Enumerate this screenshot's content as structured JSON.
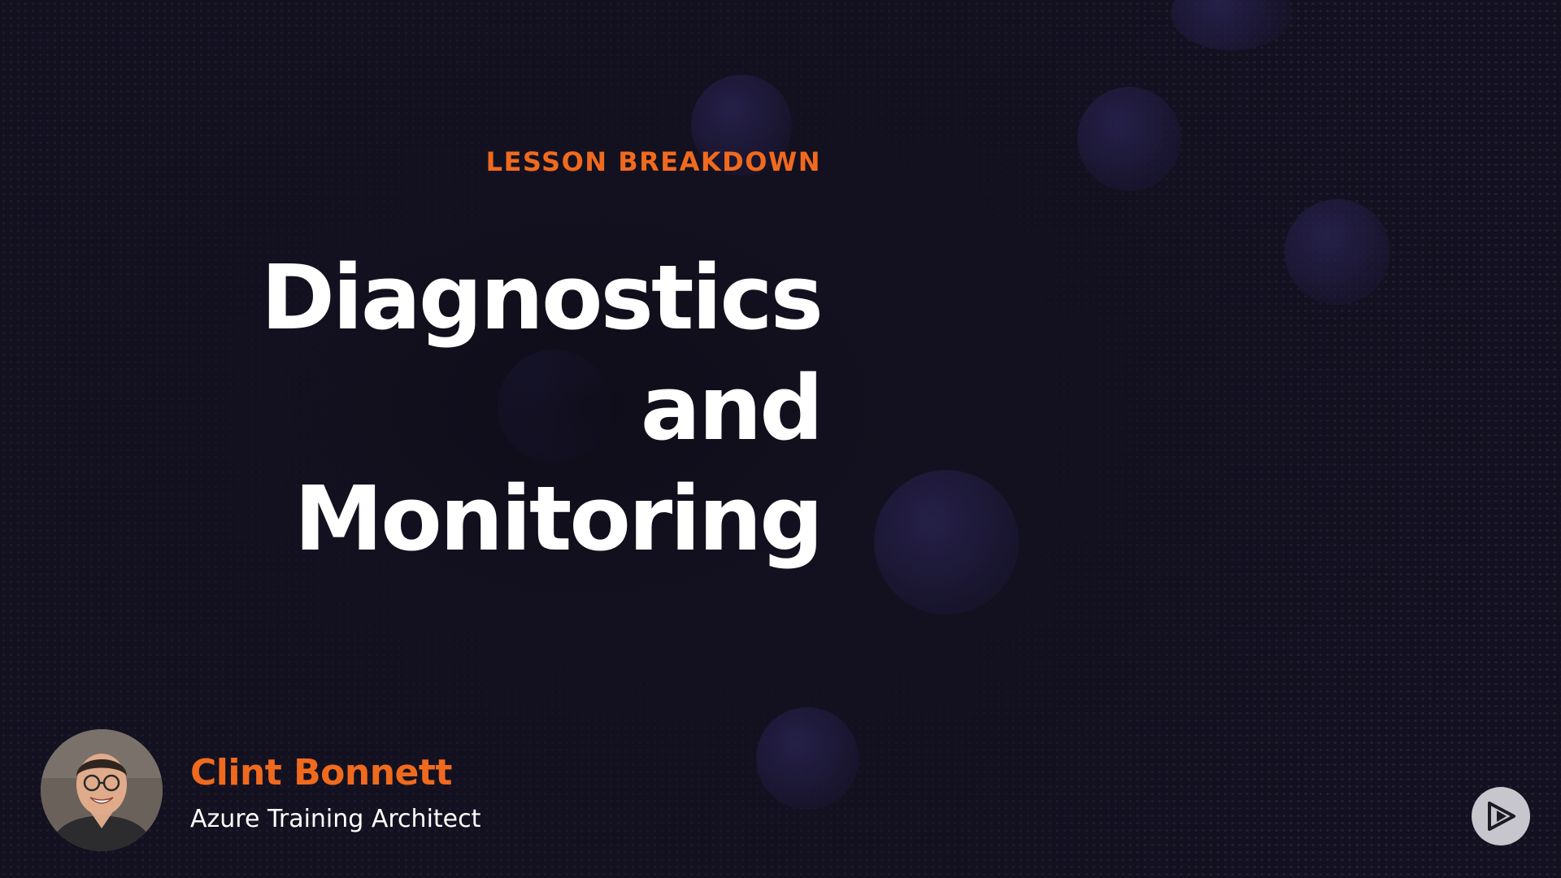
{
  "slide": {
    "eyebrow": "LESSON BREAKDOWN",
    "title_lines": [
      "Diagnostics",
      "and",
      "Monitoring"
    ]
  },
  "presenter": {
    "name": "Clint Bonnett",
    "role": "Azure Training Architect"
  },
  "icons": {
    "brand_logo": "play-logo-icon",
    "presenter_photo": "presenter-avatar"
  },
  "colors": {
    "background": "#13111f",
    "accent": "#f06a1e",
    "title_text": "#ffffff",
    "logo_bg": "#c7c6cc"
  }
}
